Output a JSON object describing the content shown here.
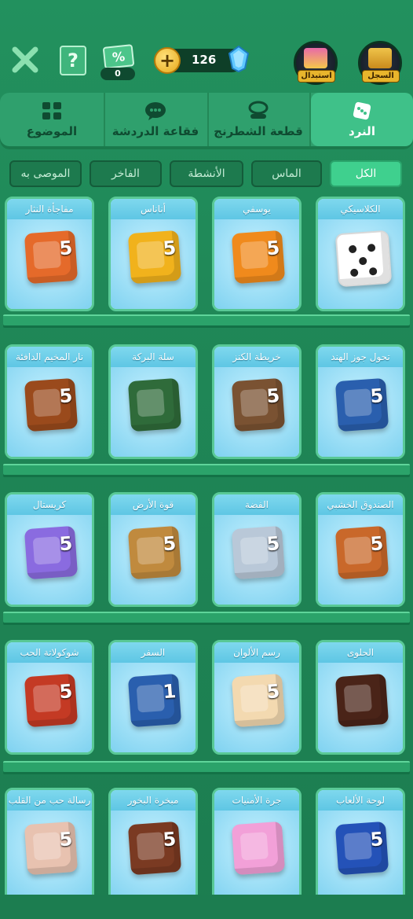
{
  "header": {
    "close_icon": "close-x-icon",
    "help_icon": "?",
    "coupon_icon": "%",
    "coupon_count": "0",
    "gem_count": "126",
    "exchange_label": "استبدال",
    "history_label": "السجل"
  },
  "tabs": [
    {
      "label": "الموضوع",
      "icon": "grid-icon",
      "active": false
    },
    {
      "label": "فقاعة الدردشة",
      "icon": "chat-bubble-icon",
      "active": false
    },
    {
      "label": "قطعة الشطرنج",
      "icon": "chess-piece-icon",
      "active": false
    },
    {
      "label": "النرد",
      "icon": "dice-icon",
      "active": true
    }
  ],
  "filters": [
    {
      "label": "الموصى به",
      "active": false
    },
    {
      "label": "الفاخر",
      "active": false
    },
    {
      "label": "الأنشطة",
      "active": false
    },
    {
      "label": "الماس",
      "active": false
    },
    {
      "label": "الكل",
      "active": true
    }
  ],
  "dice_rows": [
    [
      {
        "name": "مفاجأة النثار",
        "color": "#e56a2a",
        "digit": "5"
      },
      {
        "name": "أناناس",
        "color": "#f1b21c",
        "digit": "5"
      },
      {
        "name": "يوسفي",
        "color": "#f08a1c",
        "digit": "5"
      },
      {
        "name": "الكلاسيكي",
        "color": "#ffffff",
        "digit": ""
      }
    ],
    [
      {
        "name": "نار المخيم الدافئة",
        "color": "#9a4a1c",
        "digit": "5"
      },
      {
        "name": "سلة البركة",
        "color": "#2f6b3a",
        "digit": ""
      },
      {
        "name": "خريطة الكنز",
        "color": "#7a5232",
        "digit": "5"
      },
      {
        "name": "تحول جوز الهند",
        "color": "#2a5fae",
        "digit": "5"
      }
    ],
    [
      {
        "name": "كريستال",
        "color": "#8a6be0",
        "digit": "5"
      },
      {
        "name": "قوة الأرض",
        "color": "#c08a3e",
        "digit": "5"
      },
      {
        "name": "الفضة",
        "color": "#b9c8d8",
        "digit": "5"
      },
      {
        "name": "الصندوق الخشبي",
        "color": "#c9682a",
        "digit": "5"
      }
    ],
    [
      {
        "name": "شوكولاتة الحب",
        "color": "#c43a24",
        "digit": "5"
      },
      {
        "name": "السفر",
        "color": "#2a5fae",
        "digit": "1"
      },
      {
        "name": "رسم الألوان",
        "color": "#f3d9b0",
        "digit": "5"
      },
      {
        "name": "الحلوى",
        "color": "#4a2418",
        "digit": ""
      }
    ],
    [
      {
        "name": "رسالة حب من القلب",
        "color": "#e8c2b0",
        "digit": "5"
      },
      {
        "name": "مبخرة البخور",
        "color": "#7a3a22",
        "digit": "5"
      },
      {
        "name": "جرة الأمنيات",
        "color": "#f2a0d8",
        "digit": ""
      },
      {
        "name": "لوحة الألعاب",
        "color": "#2452b8",
        "digit": "5"
      }
    ]
  ]
}
